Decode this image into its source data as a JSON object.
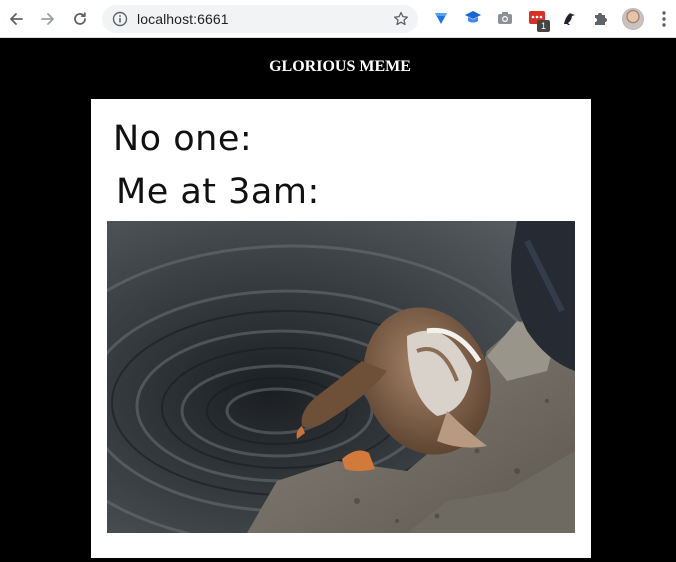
{
  "browser": {
    "url": "localhost:6661",
    "extension_badge_count": "1",
    "icons": [
      "back-arrow-icon",
      "forward-arrow-icon",
      "reload-icon",
      "info-icon",
      "bookmark-star-icon",
      "diamond-extension-icon",
      "graduation-cap-extension-icon",
      "camera-extension-icon",
      "red-extension-icon",
      "bird-extension-icon",
      "puzzle-extensions-icon",
      "profile-avatar",
      "kebab-menu-icon"
    ]
  },
  "page": {
    "title": "GLORIOUS MEME"
  },
  "meme": {
    "line1": "No one:",
    "line2": "Me at 3am:",
    "photo_subject": "duck"
  },
  "colors": {
    "page_background": "#000000",
    "card_background": "#ffffff",
    "title_color": "#ffffff"
  }
}
